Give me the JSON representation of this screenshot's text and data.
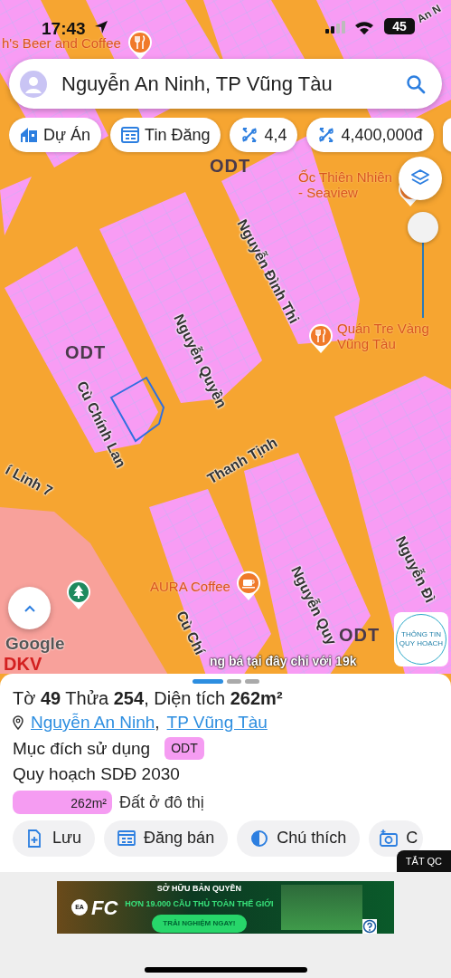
{
  "status_bar": {
    "time": "17:43",
    "battery": "45"
  },
  "search": {
    "value": "Nguyễn An Ninh, TP Vũng Tàu"
  },
  "chips": [
    {
      "kind": "project",
      "label": "Dự Án"
    },
    {
      "kind": "listing",
      "label": "Tin Đăng"
    },
    {
      "kind": "ratio",
      "label": "4,4"
    },
    {
      "kind": "ratio",
      "label": "4,400,000đ"
    }
  ],
  "map_labels": [
    {
      "kind": "restaurant",
      "text": "h's Beer and Coffee"
    },
    {
      "kind": "street",
      "text": "An N"
    },
    {
      "kind": "zone",
      "text": "ODT"
    },
    {
      "kind": "poi",
      "text": "Ốc Thiên Nhiên\n- Seaview"
    },
    {
      "kind": "street",
      "text": "Nguyễn Đình Thi"
    },
    {
      "kind": "restaurant",
      "text": "Quán Tre Vàng\nVũng Tàu"
    },
    {
      "kind": "zone",
      "text": "ODT"
    },
    {
      "kind": "street",
      "text": "Nguyễn Quyền"
    },
    {
      "kind": "street",
      "text": "Cù Chính Lan"
    },
    {
      "kind": "street",
      "text": "Thanh Tịnh"
    },
    {
      "kind": "street",
      "text": "í Linh 7"
    },
    {
      "kind": "cafe",
      "text": "AURA Coffee"
    },
    {
      "kind": "street",
      "text": "Nguyễn Quy"
    },
    {
      "kind": "street",
      "text": "Nguyễn Đì"
    },
    {
      "kind": "street",
      "text": "Cù Chí"
    },
    {
      "kind": "zone",
      "text": "ODT"
    },
    {
      "kind": "zone_alt",
      "text": "DKV"
    }
  ],
  "map_controls": {
    "opacity_slider": {
      "level": 1
    },
    "attribution": "Google",
    "ticker": "ng bá tại đây chỉ với 19k",
    "info_badge": "THÔNG TIN QUY HOẠCH"
  },
  "sheet": {
    "pager": [
      {
        "selected": true
      },
      {
        "selected": false
      },
      {
        "selected": false
      }
    ],
    "title": "Tờ **49** Thửa **254**, Diện tích **262m²**",
    "address": [
      "Nguyễn An Ninh",
      "TP Vũng Tàu"
    ],
    "address_separator": ",",
    "purpose_label": "Mục đích sử dụng",
    "purpose_tag": "ODT",
    "plan": "Quy hoạch SDĐ 2030",
    "land_use": {
      "level": 1,
      "area": "262m²",
      "label": "Đất ở đô thị"
    },
    "actions": [
      {
        "kind": "save",
        "label": "Lưu"
      },
      {
        "kind": "sell",
        "label": "Đăng bán"
      },
      {
        "kind": "legend",
        "label": "Chú thích"
      },
      {
        "kind": "photo",
        "label": "C"
      }
    ],
    "ads_off": "TẮT QC"
  },
  "ad": {
    "logo_small": "EA",
    "logo": "FC",
    "headline": "SỞ HỮU BẢN QUYỀN",
    "subline": "HƠN 19.000 CẦU THỦ TOÀN THẾ GIỚI",
    "cta": "TRẢI NGHIỆM NGAY!"
  }
}
